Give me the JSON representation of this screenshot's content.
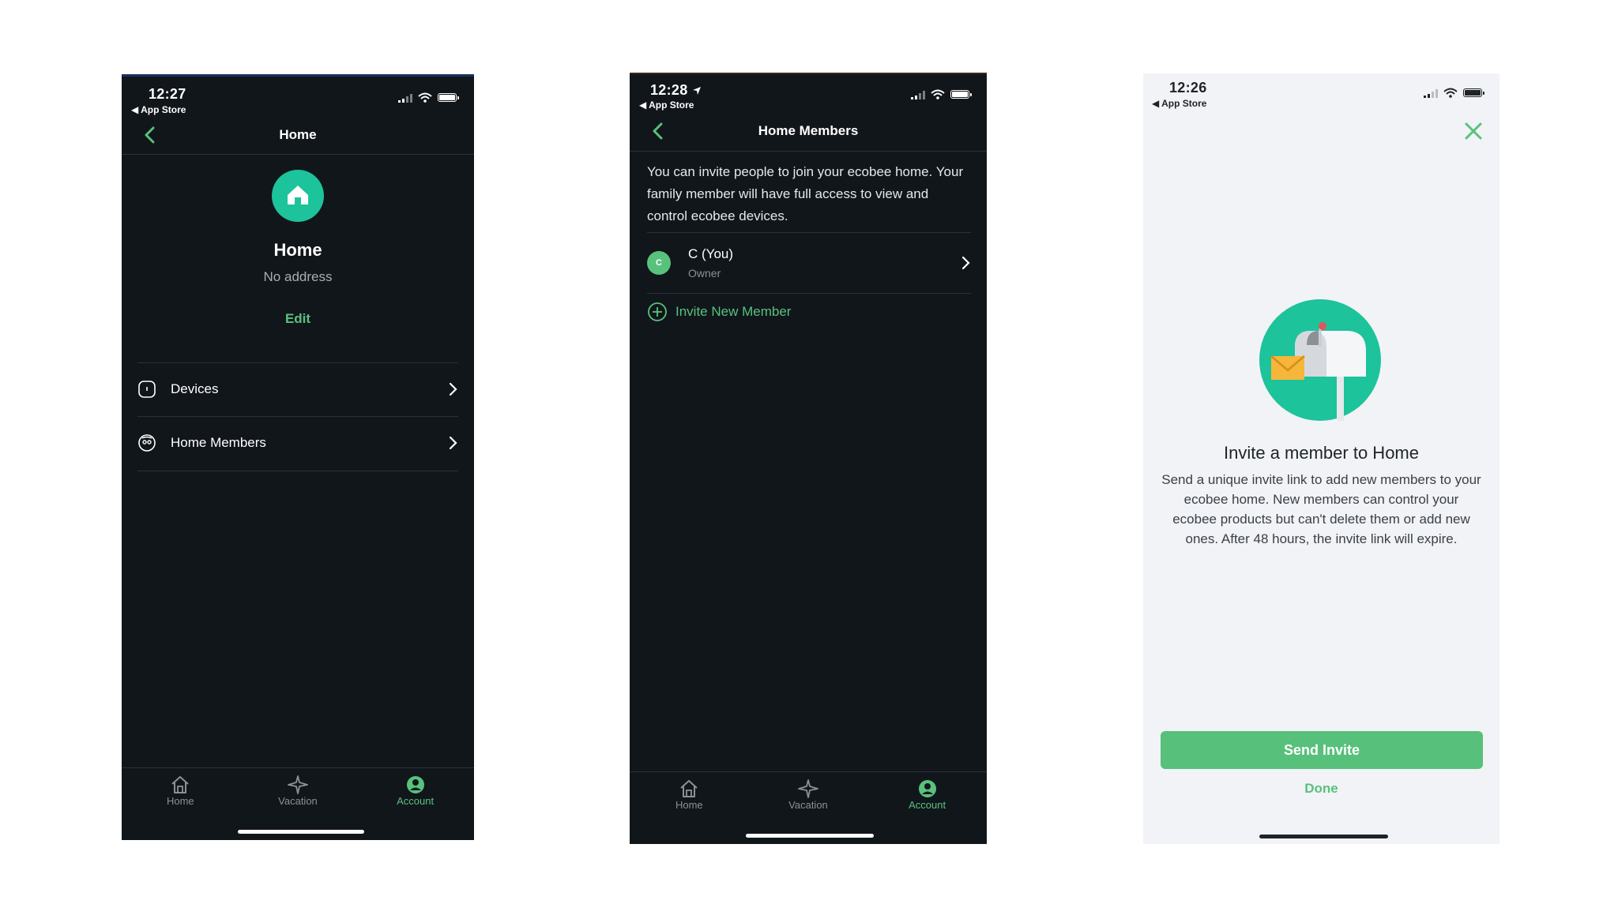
{
  "screens": [
    {
      "status": {
        "time": "12:27",
        "back_app": "◀ App Store"
      },
      "nav_title": "Home",
      "home_name": "Home",
      "address": "No address",
      "edit_label": "Edit",
      "rows": [
        {
          "label": "Devices",
          "icon": "device-icon"
        },
        {
          "label": "Home Members",
          "icon": "members-icon"
        }
      ],
      "tabs": [
        {
          "label": "Home",
          "icon": "home-icon"
        },
        {
          "label": "Vacation",
          "icon": "plane-icon"
        },
        {
          "label": "Account",
          "icon": "account-icon",
          "active": true
        }
      ]
    },
    {
      "status": {
        "time": "12:28",
        "back_app": "◀ App Store"
      },
      "nav_title": "Home Members",
      "description": "You can invite people to join your ecobee home. Your family member will have full access to view and control ecobee devices.",
      "member": {
        "initial": "C",
        "name": "C (You)",
        "role": "Owner"
      },
      "invite_label": "Invite New Member",
      "tabs": [
        {
          "label": "Home",
          "icon": "home-icon"
        },
        {
          "label": "Vacation",
          "icon": "plane-icon"
        },
        {
          "label": "Account",
          "icon": "account-icon",
          "active": true
        }
      ]
    },
    {
      "status": {
        "time": "12:26",
        "back_app": "◀ App Store"
      },
      "heading": "Invite a member to Home",
      "body": "Send a unique invite link to add new members to your ecobee home. New members can control your ecobee products but can't delete them or add new ones. After 48 hours, the invite link will expire.",
      "send_label": "Send Invite",
      "done_label": "Done"
    }
  ],
  "colors": {
    "accent": "#58c27d",
    "dark_bg": "#11161b",
    "light_bg": "#f1f3f7",
    "teal": "#1dc39a"
  }
}
